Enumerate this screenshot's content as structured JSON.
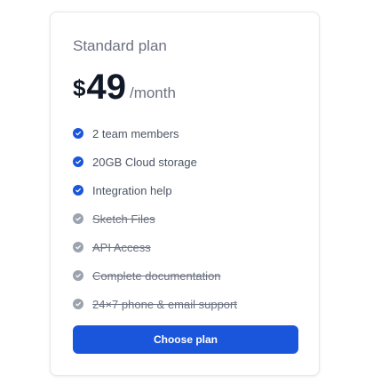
{
  "plan": {
    "name": "Standard plan",
    "currency": "$",
    "amount": "49",
    "period": "/month"
  },
  "features": [
    {
      "label": "2 team members",
      "included": true
    },
    {
      "label": "20GB Cloud storage",
      "included": true
    },
    {
      "label": "Integration help",
      "included": true
    },
    {
      "label": "Sketch Files",
      "included": false
    },
    {
      "label": "API Access",
      "included": false
    },
    {
      "label": "Complete documentation",
      "included": false
    },
    {
      "label": "24×7 phone & email support",
      "included": false
    }
  ],
  "icons": {
    "included": "check-circle-icon",
    "excluded": "check-circle-icon"
  },
  "colors": {
    "accent": "#1a56db",
    "included_check": "#1a56db",
    "excluded_check": "#9ca3af"
  },
  "button": {
    "label": "Choose plan"
  }
}
